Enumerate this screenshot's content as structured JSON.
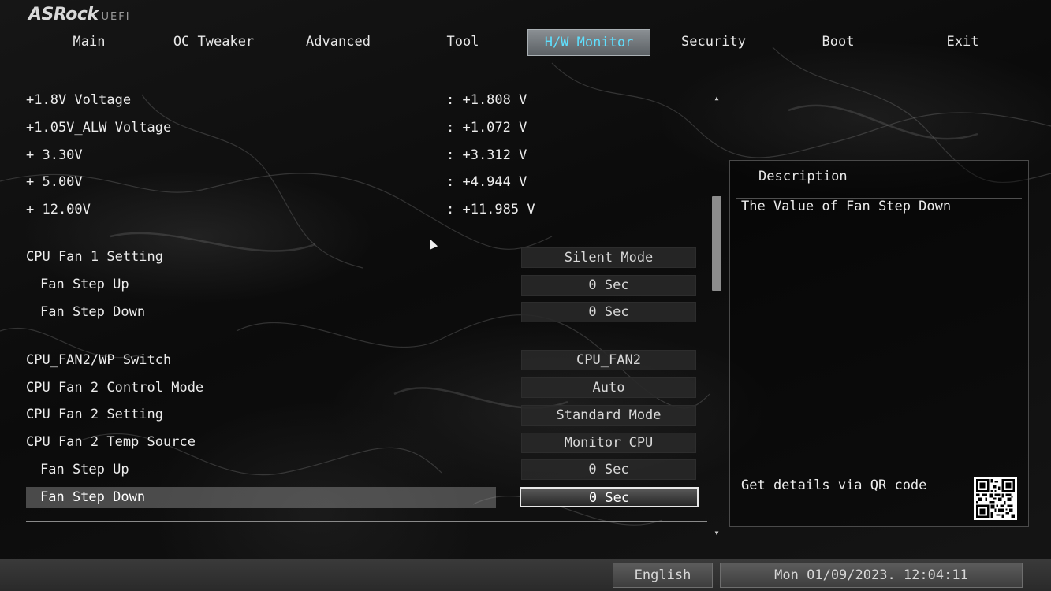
{
  "logo": {
    "brand": "ASRock",
    "sub": "UEFI"
  },
  "tabs": [
    "Main",
    "OC Tweaker",
    "Advanced",
    "Tool",
    "H/W Monitor",
    "Security",
    "Boot",
    "Exit"
  ],
  "active_tab": "H/W Monitor",
  "active_tab_color": "#5fe0ff",
  "voltages": [
    {
      "label": "+1.8V Voltage",
      "value": ": +1.808 V"
    },
    {
      "label": "+1.05V_ALW Voltage",
      "value": ": +1.072 V"
    },
    {
      "label": "+ 3.30V",
      "value": ": +3.312 V"
    },
    {
      "label": "+ 5.00V",
      "value": ": +4.944 V"
    },
    {
      "label": "+ 12.00V",
      "value": ": +11.985 V"
    }
  ],
  "cpu_fan1": [
    {
      "label": "CPU Fan 1 Setting",
      "value": "Silent Mode"
    },
    {
      "label": "Fan Step Up",
      "value": "0 Sec"
    },
    {
      "label": "Fan Step Down",
      "value": "0 Sec"
    }
  ],
  "cpu_fan2": [
    {
      "label": "CPU_FAN2/WP Switch",
      "value": "CPU_FAN2"
    },
    {
      "label": "CPU Fan 2 Control Mode",
      "value": "Auto"
    },
    {
      "label": "CPU Fan 2 Setting",
      "value": "Standard Mode"
    },
    {
      "label": "CPU Fan 2 Temp Source",
      "value": "Monitor CPU"
    },
    {
      "label": "Fan Step Up",
      "value": "0 Sec"
    },
    {
      "label": "Fan Step Down",
      "value": "0 Sec"
    }
  ],
  "description": {
    "title": "Description",
    "text": "The Value of Fan Step Down",
    "qr_text": "Get details via QR code"
  },
  "footer": {
    "language": "English",
    "datetime": "Mon 01/09/2023. 12:04:11"
  },
  "scrollbar": {
    "up_icon": "▲",
    "down_icon": "▼"
  }
}
